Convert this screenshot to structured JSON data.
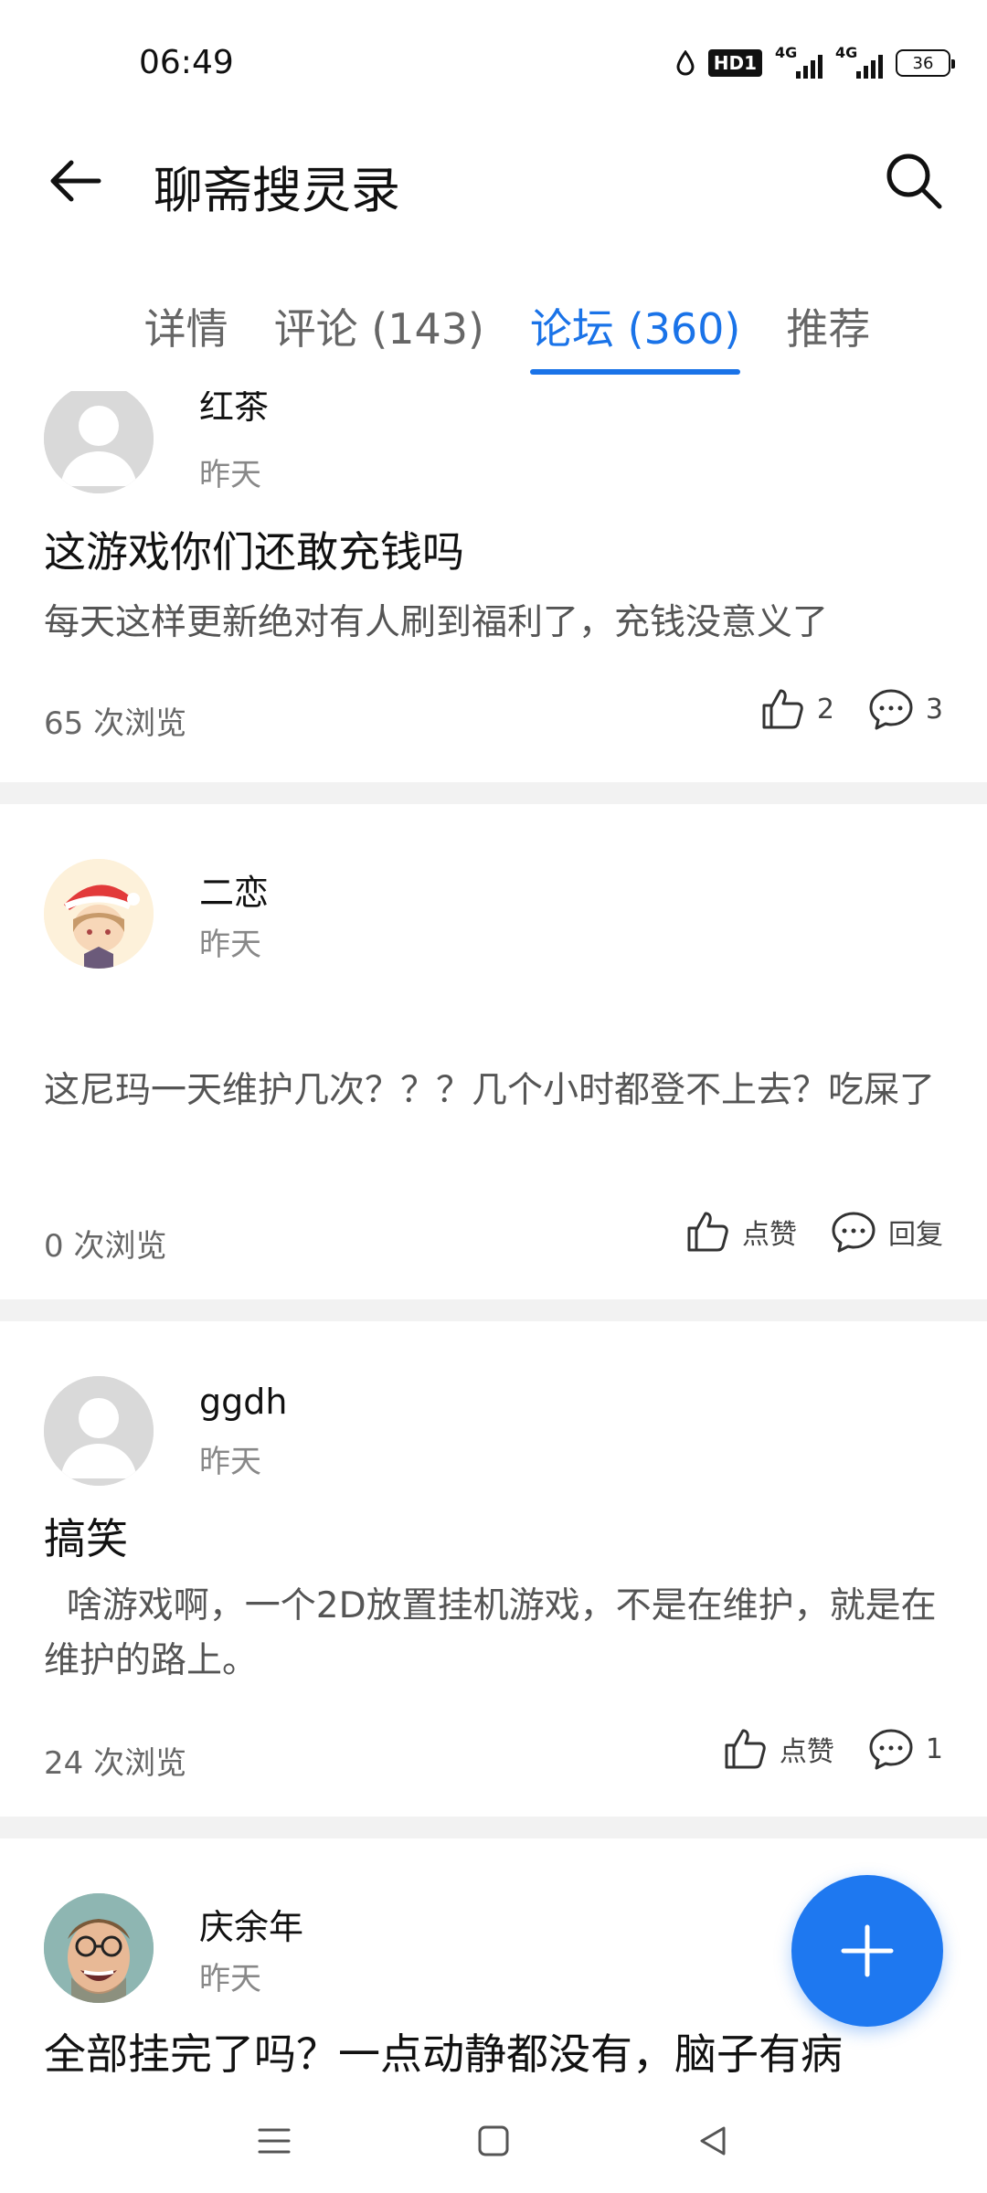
{
  "status": {
    "time": "06:49",
    "hd_label": "HD1",
    "net1": "4G",
    "net2": "4G",
    "battery": "36"
  },
  "app_bar": {
    "title": "聊斋搜灵录"
  },
  "tabs": [
    {
      "label": "详情",
      "active": false
    },
    {
      "label": "评论 (143)",
      "active": false
    },
    {
      "label": "论坛 (360)",
      "active": true
    },
    {
      "label": "推荐",
      "active": false
    }
  ],
  "posts": [
    {
      "author": "红茶",
      "time": "昨天",
      "title": "这游戏你们还敢充钱吗",
      "body": "每天这样更新绝对有人刷到福利了，充钱没意义了",
      "views": "65 次浏览",
      "likes": "2",
      "replies": "3"
    },
    {
      "author": "二恋",
      "time": "昨天",
      "title": "",
      "body": "这尼玛一天维护几次？？？几个小时都登不上去？吃屎了",
      "views": "0 次浏览",
      "likes": "点赞",
      "replies": "回复"
    },
    {
      "author": "ggdh",
      "time": "昨天",
      "title": "搞笑",
      "body": "  啥游戏啊，一个2D放置挂机游戏，不是在维护，就是在维护的路上。",
      "views": "24 次浏览",
      "likes": "点赞",
      "replies": "1"
    },
    {
      "author": "庆余年",
      "time": "昨天",
      "title": "全部挂完了吗？一点动静都没有，脑子有病",
      "body": "",
      "views": "",
      "likes": "",
      "replies": ""
    }
  ],
  "icons": {
    "back": "arrow-left-icon",
    "search": "search-icon",
    "like": "thumbs-up-icon",
    "reply": "comment-icon",
    "fab": "plus-icon"
  },
  "colors": {
    "accent": "#1a73e8",
    "fab": "#1e78f0"
  }
}
